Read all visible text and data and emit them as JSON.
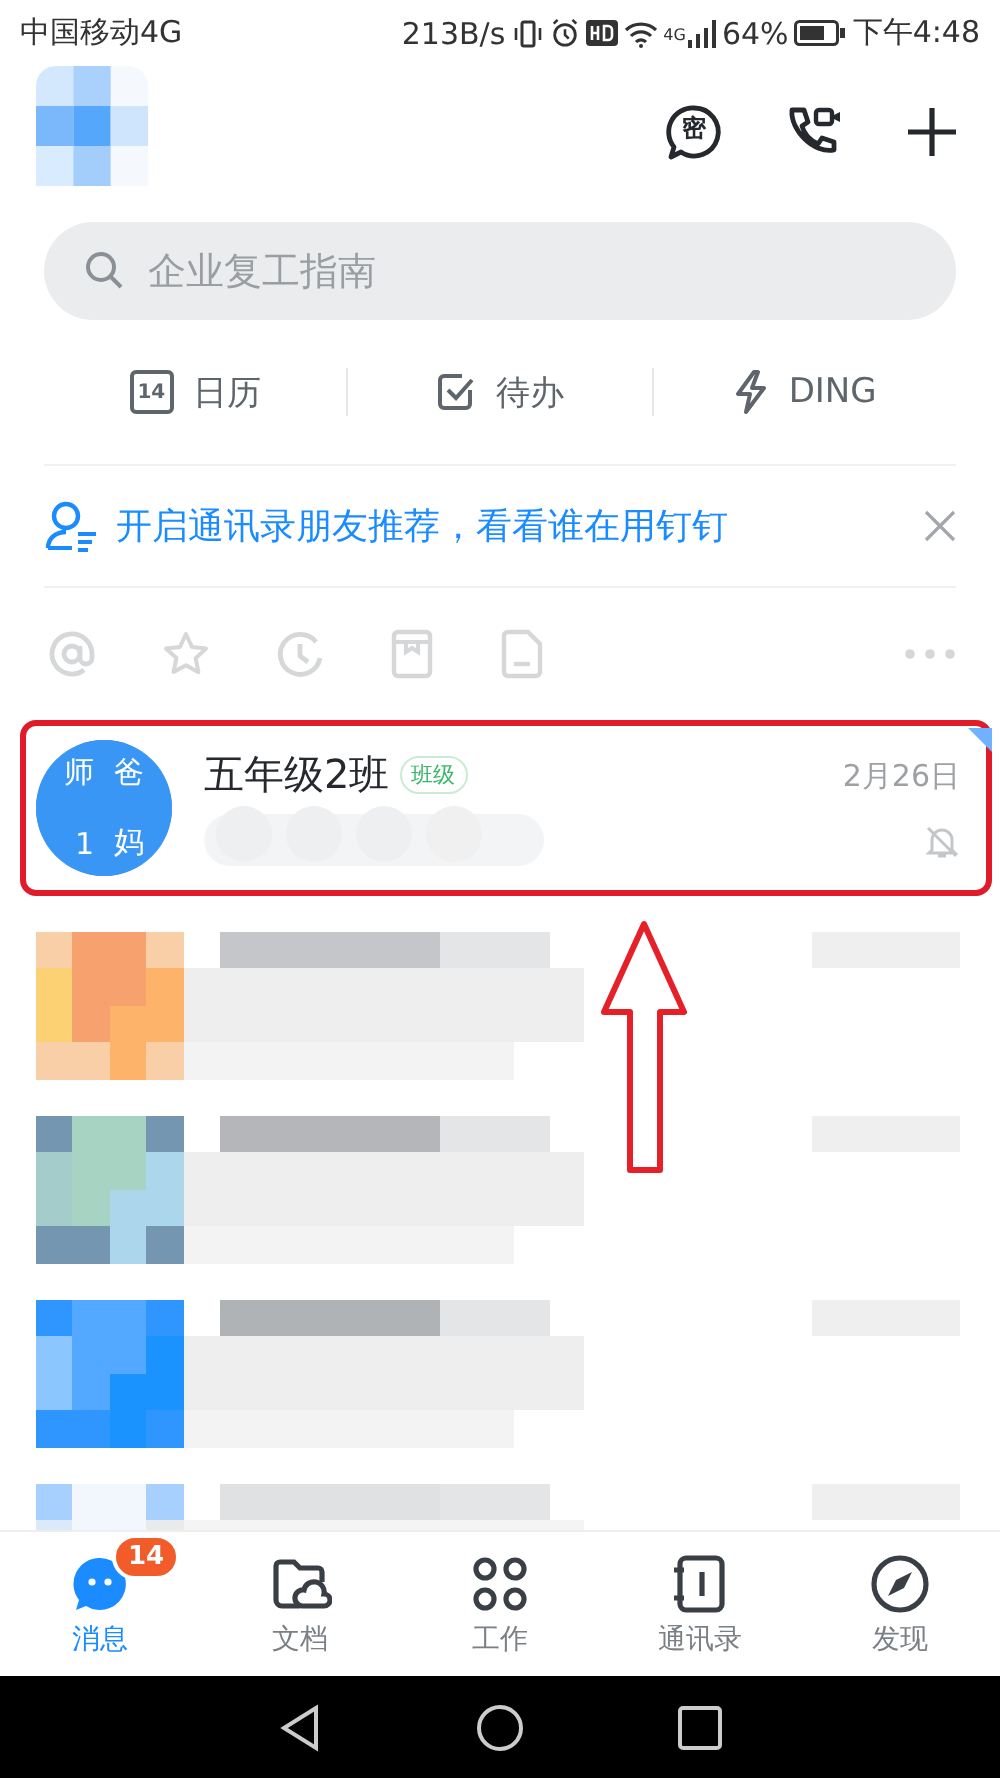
{
  "status_bar": {
    "carrier": "中国移动4G",
    "speed": "213B/s",
    "network": "4G",
    "battery": "64%",
    "time": "下午4:48"
  },
  "header": {
    "secret_glyph": "密",
    "avatar": {
      "kind": "picture"
    }
  },
  "search": {
    "placeholder": "企业复工指南"
  },
  "shortcuts": [
    {
      "kind": "calendar",
      "icon_text": "14",
      "label": "日历"
    },
    {
      "kind": "todo",
      "label": "待办"
    },
    {
      "kind": "ding",
      "label": "DING"
    }
  ],
  "banner": {
    "text": "开启通讯录朋友推荐，看看谁在用钉钉",
    "closable": true
  },
  "chats": [
    {
      "kind": "group",
      "name": "五年级2班",
      "tag": "班级",
      "date": "2月26日",
      "muted": true,
      "unread_corner": true,
      "highlighted": true,
      "avatar_chars": [
        "师",
        "爸",
        "1",
        "妈"
      ]
    },
    {
      "kind": "picture"
    },
    {
      "kind": "picture"
    },
    {
      "kind": "picture"
    },
    {
      "kind": "picture"
    }
  ],
  "tabs": [
    {
      "label": "消息",
      "kind": "chat",
      "selected": true,
      "badge": "14"
    },
    {
      "label": "文档",
      "kind": "docs",
      "selected": false
    },
    {
      "label": "工作",
      "kind": "work",
      "selected": false
    },
    {
      "label": "通讯录",
      "kind": "contacts",
      "selected": false
    },
    {
      "label": "发现",
      "kind": "discover",
      "selected": false
    }
  ]
}
